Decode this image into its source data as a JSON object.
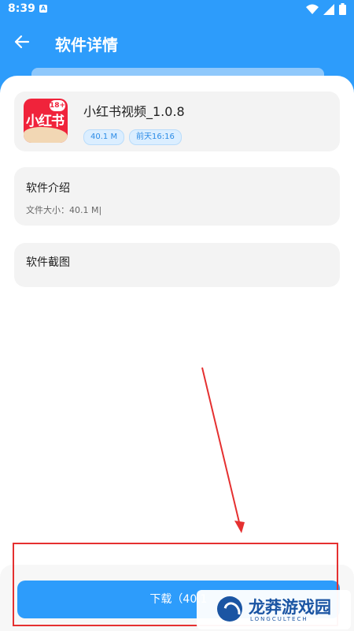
{
  "status_bar": {
    "time": "8:39",
    "notification_icon": "a-icon",
    "icons": [
      "wifi-icon",
      "signal-icon",
      "battery-icon"
    ]
  },
  "nav": {
    "title": "软件详情",
    "back_icon": "arrow-left-icon"
  },
  "app": {
    "name": "小红书视频_1.0.8",
    "icon_text": "小红书",
    "icon_badge": "18+",
    "size_tag": "40.1 M",
    "time_tag": "前天16:16"
  },
  "intro": {
    "title": "软件介绍",
    "size_text": "文件大小：40.1 M|"
  },
  "screenshots": {
    "title": "软件截图"
  },
  "download": {
    "label": "下载（40.1"
  },
  "watermark": {
    "name": "龙莽游戏园",
    "sub": "LONGCULTECH"
  },
  "colors": {
    "primary": "#2d9cfb",
    "annotation": "#e53030",
    "card_bg": "#f3f3f3"
  }
}
